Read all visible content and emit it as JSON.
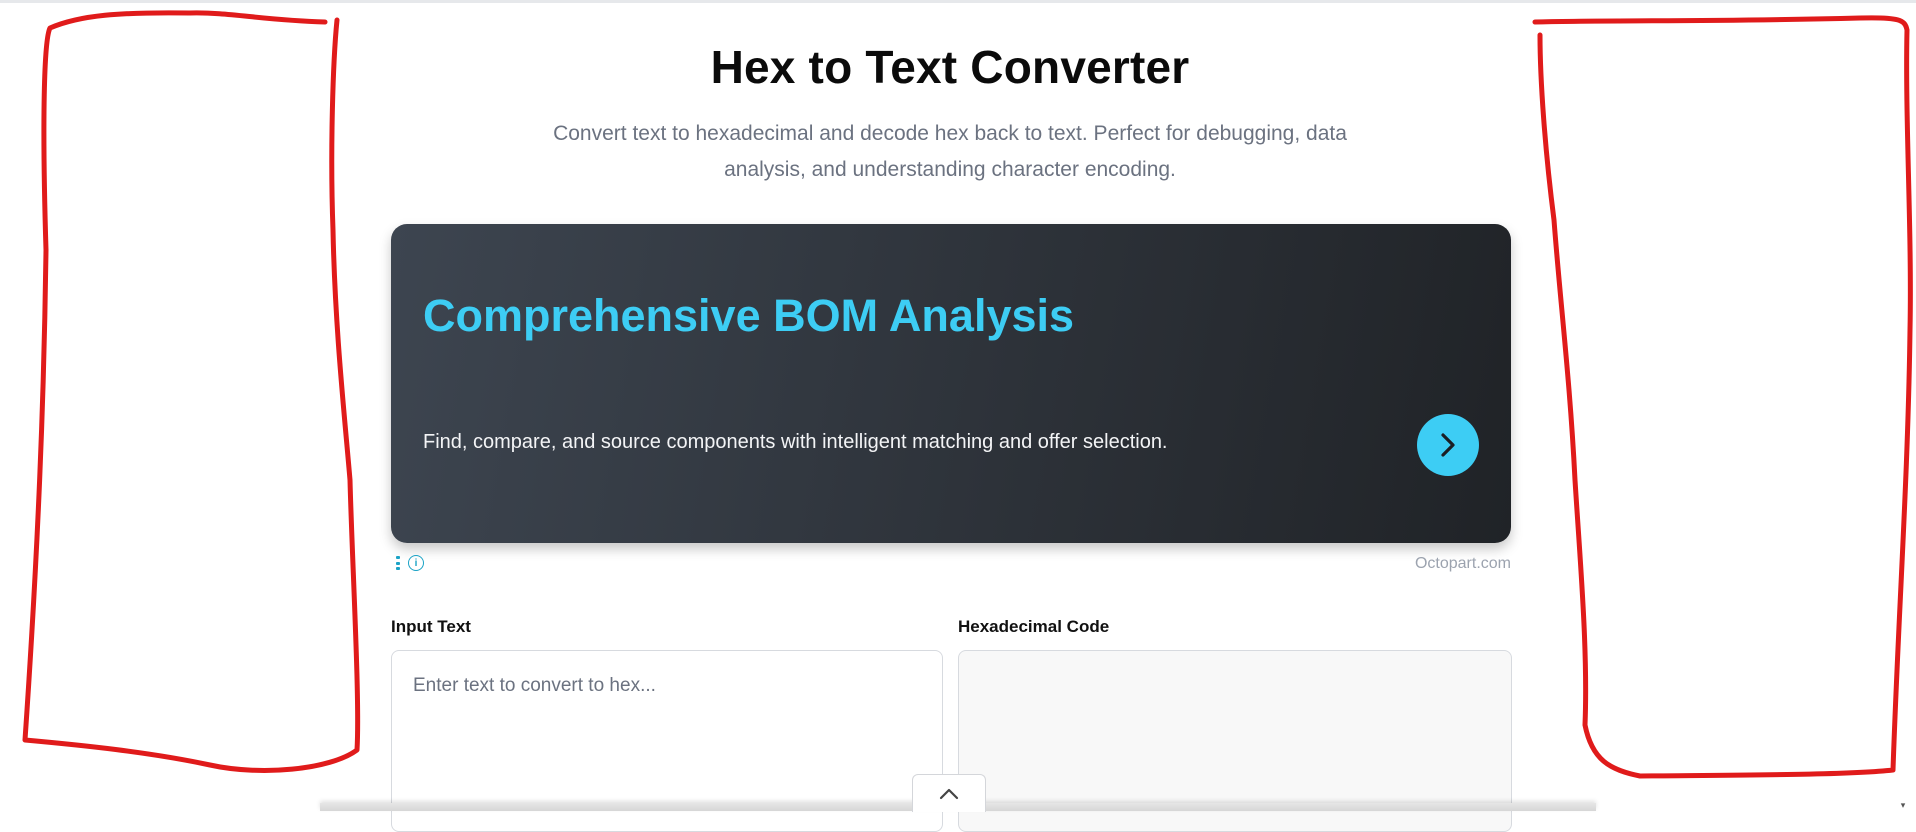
{
  "header": {
    "title": "Hex to Text Converter",
    "subtitle": "Convert text to hexadecimal and decode hex back to text. Perfect for debugging, data analysis, and understanding character encoding."
  },
  "ad": {
    "headline": "Comprehensive BOM Analysis",
    "description": "Find, compare, and source components with intelligent matching and offer selection.",
    "source": "Octopart.com",
    "arrow_icon": "chevron-right-icon",
    "accent_color": "#3dcdf4"
  },
  "converter": {
    "input_label": "Input Text",
    "input_placeholder": "Enter text to convert to hex...",
    "output_label": "Hexadecimal Code"
  },
  "annotations": {
    "color": "#e01b1b",
    "description": "two hand-drawn red outlines in left and right margins"
  },
  "icons": {
    "collapse": "chevron-up-icon",
    "menu": "kebab-menu-icon",
    "info": "info-icon",
    "scroll": "scroll-down-arrow-icon"
  }
}
